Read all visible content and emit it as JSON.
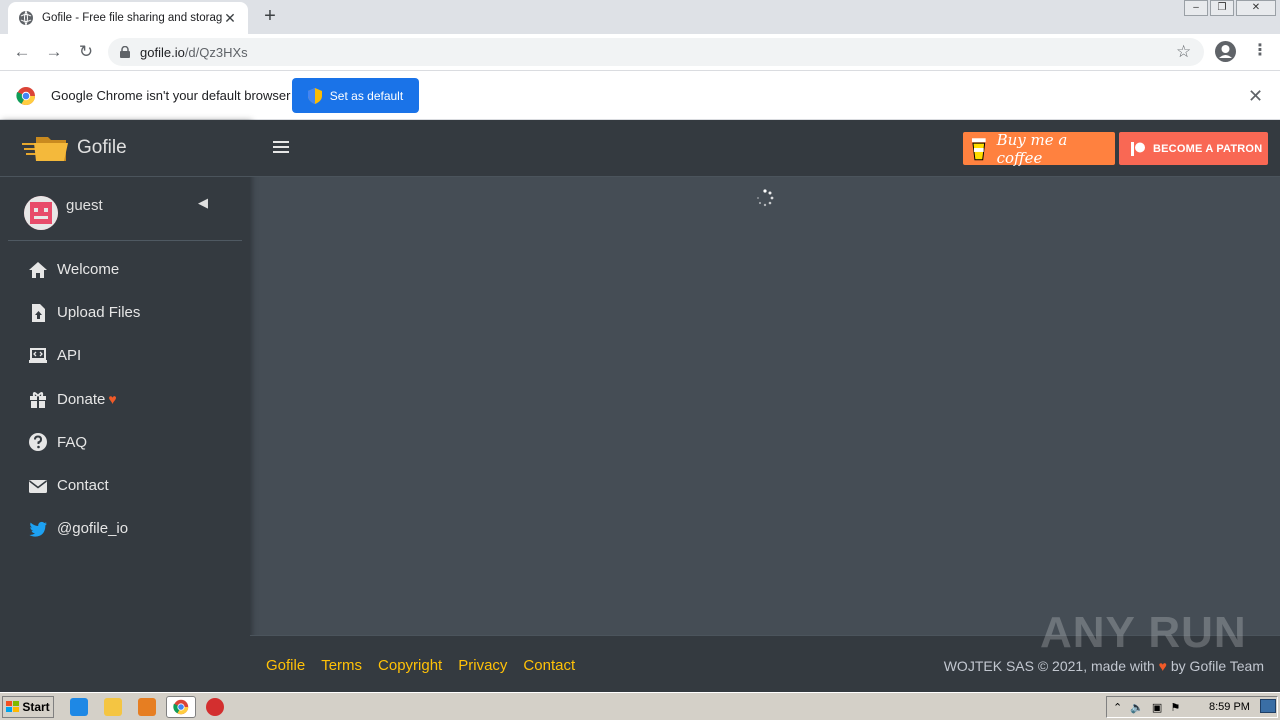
{
  "browser": {
    "tab_title": "Gofile - Free file sharing and storage",
    "url_host": "gofile.io",
    "url_path": "/d/Qz3HXs",
    "infobar_text": "Google Chrome isn't your default browser",
    "set_default_label": "Set as default"
  },
  "app": {
    "brand": "Gofile",
    "user": "guest",
    "nav": [
      {
        "label": "Welcome",
        "icon": "home-icon"
      },
      {
        "label": "Upload Files",
        "icon": "file-upload-icon"
      },
      {
        "label": "API",
        "icon": "laptop-code-icon"
      },
      {
        "label": "Donate",
        "icon": "gift-icon"
      },
      {
        "label": "FAQ",
        "icon": "question-circle-icon"
      },
      {
        "label": "Contact",
        "icon": "envelope-icon"
      },
      {
        "label": "@gofile_io",
        "icon": "twitter-icon"
      }
    ],
    "buy_coffee_label": "Buy me a coffee",
    "patron_label": "BECOME A PATRON",
    "footer_links": [
      "Gofile",
      "Terms",
      "Copyright",
      "Privacy",
      "Contact"
    ],
    "footer_copyright_prefix": "WOJTEK SAS © 2021, made with",
    "footer_copyright_suffix": "by Gofile Team"
  },
  "watermark": "ANY RUN",
  "taskbar": {
    "start_label": "Start",
    "clock": "8:59 PM"
  },
  "colors": {
    "sidebar_bg": "#343a40",
    "content_bg": "#454d55",
    "footer_link": "#ffc107",
    "coffee": "#ff813f",
    "patron": "#f96854",
    "chrome_blue": "#1a73e8"
  }
}
